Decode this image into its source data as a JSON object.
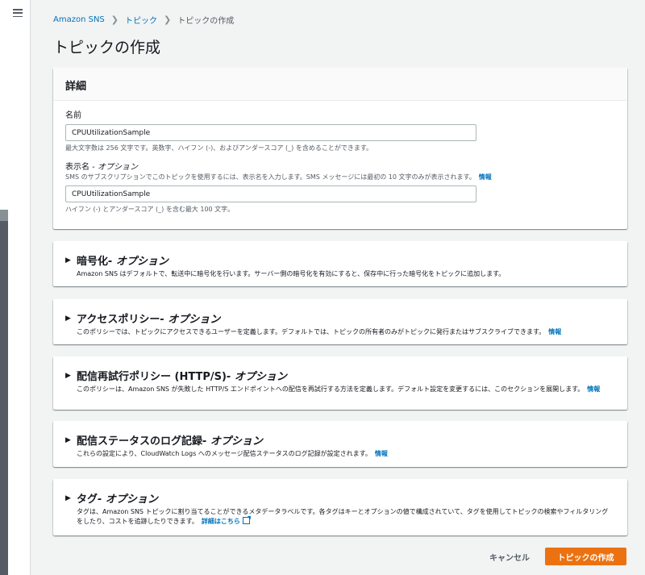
{
  "breadcrumb": {
    "root": "Amazon SNS",
    "topics": "トピック",
    "current": "トピックの作成"
  },
  "page": {
    "title": "トピックの作成"
  },
  "details": {
    "header": "詳細",
    "name_label": "名前",
    "name_value": "CPUUtilizationSample",
    "name_hint": "最大文字数は 256 文字です。英数字、ハイフン (-)、およびアンダースコア (_) を含めることができます。",
    "display_label": "表示名",
    "display_label_optional": " - オプション",
    "display_desc": "SMS のサブスクリプションでこのトピックを使用するには、表示名を入力します。SMS メッセージには最初の 10 文字のみが表示されます。",
    "display_info": "情報",
    "display_value": "CPUUtilizationSample",
    "display_hint": "ハイフン (-) とアンダースコア (_) を含む最大 100 文字。"
  },
  "sections": {
    "encryption": {
      "title": "暗号化",
      "optional": " - オプション",
      "desc": "Amazon SNS はデフォルトで、転送中に暗号化を行います。サーバー側の暗号化を有効にすると、保存中に行った暗号化をトピックに追加します。"
    },
    "access": {
      "title": "アクセスポリシー",
      "optional": " - オプション",
      "desc": "このポリシーでは、トピックにアクセスできるユーザーを定義します。デフォルトでは、トピックの所有者のみがトピックに発行またはサブスクライブできます。",
      "info": "情報"
    },
    "retry": {
      "title": "配信再試行ポリシー (HTTP/S)",
      "optional": " - オプション",
      "desc": "このポリシーは、Amazon SNS が失敗した HTTP/S エンドポイントへの配信を再試行する方法を定義します。デフォルト設定を変更するには、このセクションを展開します。",
      "info": "情報"
    },
    "logging": {
      "title": "配信ステータスのログ記録",
      "optional": " - オプション",
      "desc": "これらの設定により、CloudWatch Logs へのメッセージ配信ステータスのログ記録が設定されます。",
      "info": "情報"
    },
    "tags": {
      "title": "タグ",
      "optional": " - オプション",
      "desc": "タグは、Amazon SNS トピックに割り当てることができるメタデータラベルです。各タグはキーとオプションの値で構成されていて、タグを使用してトピックの検索やフィルタリングをしたり、コストを追跡したりできます。",
      "link": "詳細はこちら"
    }
  },
  "footer": {
    "cancel": "キャンセル",
    "create": "トピックの作成"
  }
}
